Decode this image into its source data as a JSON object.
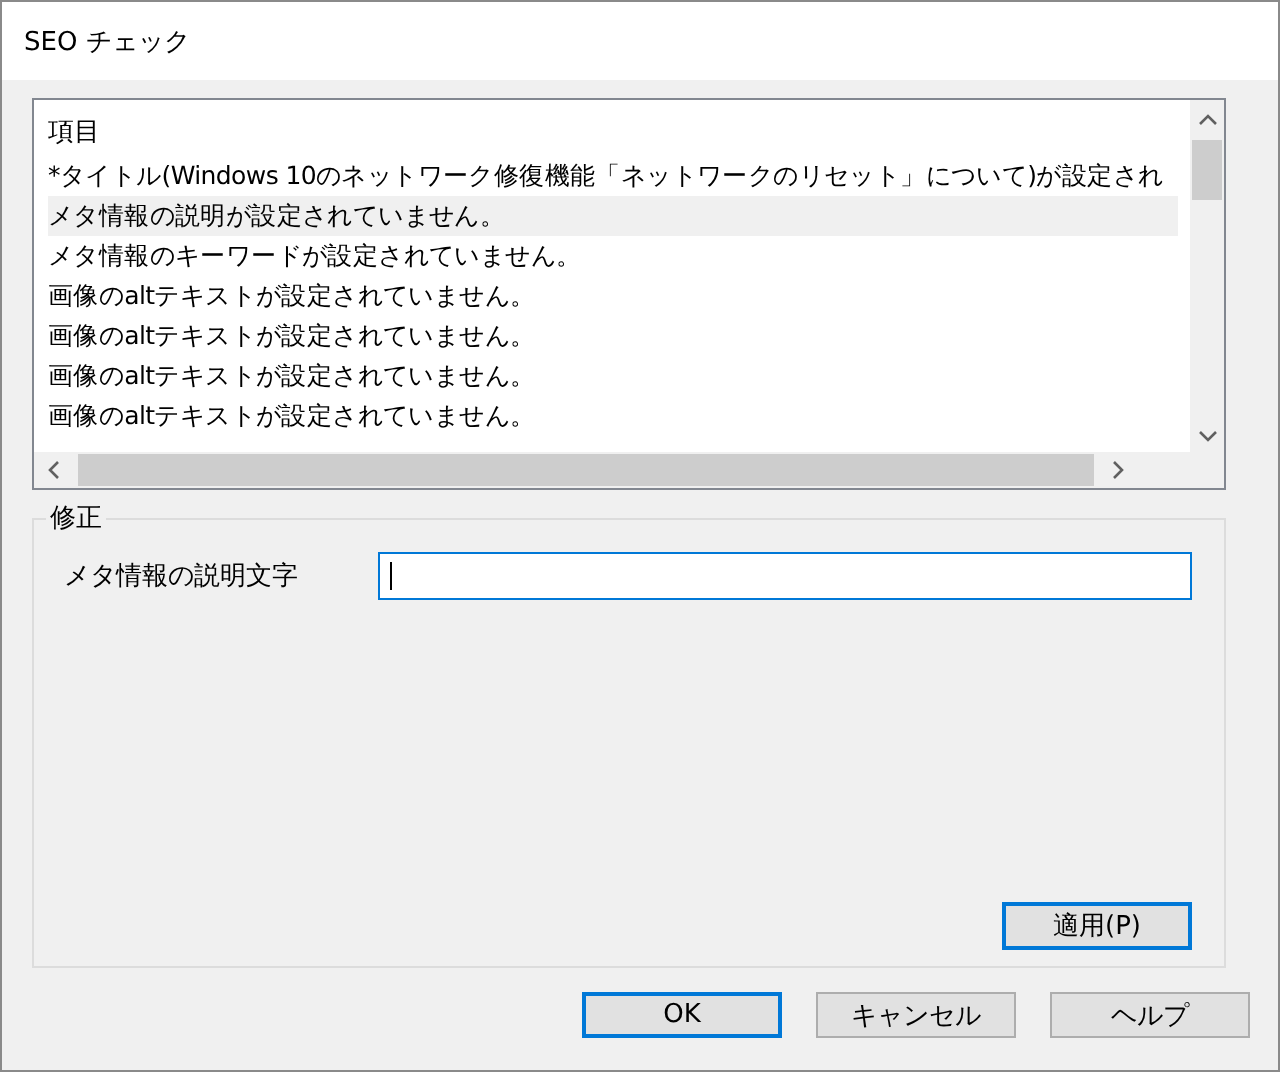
{
  "window": {
    "title": "SEO チェック"
  },
  "list": {
    "header": "項目",
    "rows": [
      {
        "text": "*タイトル(Windows 10のネットワーク修復機能「ネットワークのリセット」について)が設定され",
        "selected": false
      },
      {
        "text": "メタ情報の説明が設定されていません。",
        "selected": true
      },
      {
        "text": "メタ情報のキーワードが設定されていません。",
        "selected": false
      },
      {
        "text": "画像のaltテキストが設定されていません。",
        "selected": false
      },
      {
        "text": "画像のaltテキストが設定されていません。",
        "selected": false
      },
      {
        "text": "画像のaltテキストが設定されていません。",
        "selected": false
      },
      {
        "text": "画像のaltテキストが設定されていません。",
        "selected": false
      }
    ]
  },
  "fix": {
    "title": "修正",
    "label": "メタ情報の説明文字",
    "field": {
      "focused": true
    },
    "apply": {
      "label": "適用(P)",
      "default": true
    }
  },
  "buttons": [
    {
      "label": "OK",
      "default": true
    },
    {
      "label": "キャンセル",
      "default": false
    },
    {
      "label": "ヘルプ",
      "default": false
    }
  ]
}
